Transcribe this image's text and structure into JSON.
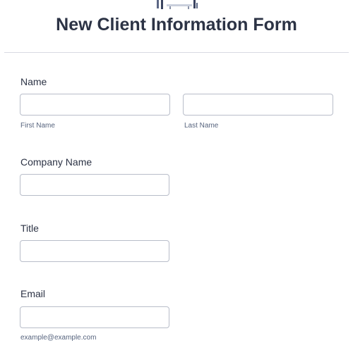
{
  "form": {
    "title": "New Client Information Form"
  },
  "fields": {
    "name": {
      "label": "Name",
      "first": {
        "value": "",
        "sublabel": "First Name"
      },
      "last": {
        "value": "",
        "sublabel": "Last Name"
      }
    },
    "company": {
      "label": "Company Name",
      "value": ""
    },
    "title": {
      "label": "Title",
      "value": ""
    },
    "email": {
      "label": "Email",
      "value": "",
      "sublabel": "example@example.com"
    }
  },
  "icons": {
    "header_illustration": "office-desk-illustration-icon"
  },
  "colors": {
    "text": "#2c3345",
    "sublabel": "#57647e",
    "input_border": "#b8bdc9",
    "divider": "#d8dae3"
  }
}
